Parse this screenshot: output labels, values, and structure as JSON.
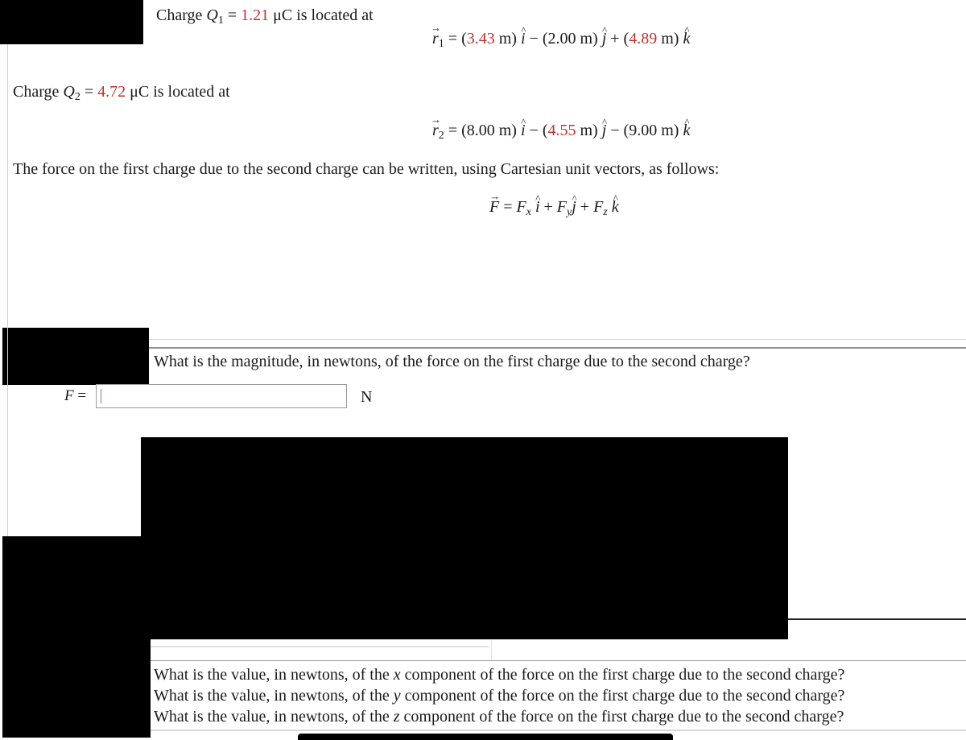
{
  "problem": {
    "q1": {
      "prefix": "Charge ",
      "symbol": "Q",
      "sub": "1",
      "eq": " = ",
      "value": "1.21",
      "unit": " μC is located at"
    },
    "r1": {
      "symbol": "r",
      "sub": "1",
      "eq": " = ",
      "terms": [
        {
          "open": "(",
          "value": "3.43",
          "red": true,
          "unit": " m)",
          "unit_vec": "i",
          "op": " − "
        },
        {
          "open": "(",
          "value": "2.00",
          "red": false,
          "unit": " m)",
          "unit_vec": "j",
          "op": " + "
        },
        {
          "open": "(",
          "value": "4.89",
          "red": true,
          "unit": " m)",
          "unit_vec": "k",
          "op": ""
        }
      ]
    },
    "q2": {
      "prefix": "Charge ",
      "symbol": "Q",
      "sub": "2",
      "eq": " = ",
      "value": "4.72",
      "unit": " μC is located at"
    },
    "r2": {
      "symbol": "r",
      "sub": "2",
      "eq": " = ",
      "terms": [
        {
          "open": "(",
          "value": "8.00",
          "red": false,
          "unit": " m)",
          "unit_vec": "i",
          "op": " − "
        },
        {
          "open": "(",
          "value": "4.55",
          "red": true,
          "unit": " m)",
          "unit_vec": "j",
          "op": " − "
        },
        {
          "open": "(",
          "value": "9.00",
          "red": false,
          "unit": " m)",
          "unit_vec": "k",
          "op": ""
        }
      ]
    },
    "force_intro": "The force on the first charge due to the second charge can be written, using Cartesian unit vectors, as follows:",
    "force_eq": {
      "lhs": "F",
      "eq": " = ",
      "fx": "F",
      "fx_sub": "x",
      "fy": "F",
      "fy_sub": "y",
      "fz": "F",
      "fz_sub": "z",
      "plus": " + ",
      "i": "i",
      "j": "j",
      "k": "k"
    }
  },
  "question_magnitude": {
    "text": "What is the magnitude, in newtons, of the force on the first charge due to the second charge?",
    "label": "F",
    "eq": " = ",
    "input_value": "",
    "unit": "N"
  },
  "questions_components": [
    {
      "pre": "What is the value, in newtons, of the ",
      "var": "x",
      "post": " component of the force on the first charge due to the second charge?"
    },
    {
      "pre": "What is the value, in newtons, of the ",
      "var": "y",
      "post": " component of the force on the first charge due to the second charge?"
    },
    {
      "pre": "What is the value, in newtons, of the ",
      "var": "z",
      "post": " component of the force on the first charge due to the second charge?"
    }
  ],
  "colors": {
    "highlight": "#c0302b",
    "text": "#1a1a1a",
    "rule": "#9a9a9a"
  }
}
